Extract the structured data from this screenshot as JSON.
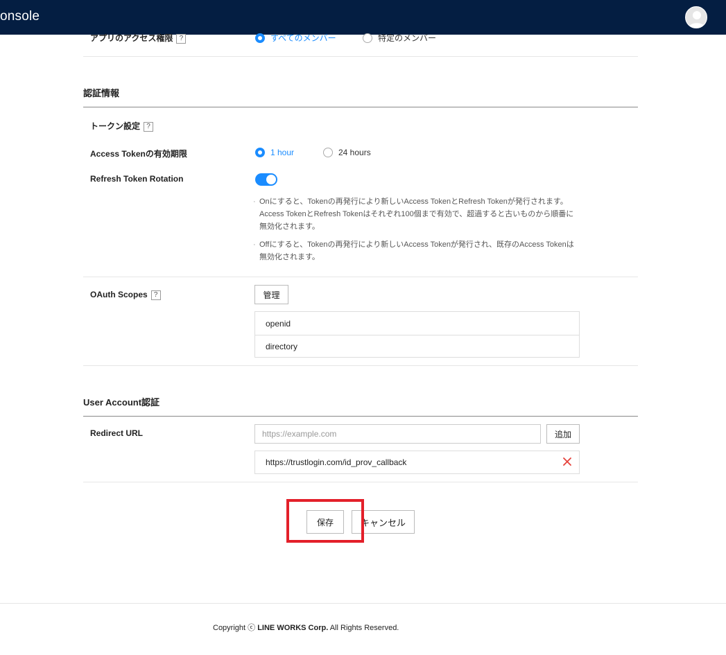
{
  "header": {
    "title": "onsole"
  },
  "access": {
    "label": "アプリのアクセス権限",
    "help": "?",
    "options": [
      "すべてのメンバー",
      "特定のメンバー"
    ],
    "selected": "すべてのメンバー"
  },
  "auth_section": {
    "title": "認証情報",
    "token_settings": {
      "label": "トークン設定",
      "help": "?"
    },
    "access_token": {
      "label": "Access Tokenの有効期限",
      "options": [
        "1 hour",
        "24 hours"
      ],
      "selected": "1 hour"
    },
    "refresh_rotation": {
      "label": "Refresh Token Rotation",
      "enabled": true,
      "notes": [
        "Onにすると、Tokenの再発行により新しいAccess TokenとRefresh Tokenが発行されます。Access TokenとRefresh Tokenはそれぞれ100個まで有効で、超過すると古いものから順番に無効化されます。",
        "Offにすると、Tokenの再発行により新しいAccess Tokenが発行され、既存のAccess Tokenは無効化されます。"
      ]
    },
    "oauth_scopes": {
      "label": "OAuth Scopes",
      "help": "?",
      "manage_label": "管理",
      "scopes": [
        "openid",
        "directory"
      ]
    }
  },
  "user_account": {
    "title": "User Account認証",
    "redirect_label": "Redirect URL",
    "input_placeholder": "https://example.com",
    "add_label": "追加",
    "urls": [
      "https://trustlogin.com/id_prov_callback"
    ]
  },
  "actions": {
    "save_label": "保存",
    "cancel_label": "キャンセル"
  },
  "footer": {
    "prefix": "Copyright ",
    "symbol": "ⓒ",
    "company": "LINE WORKS Corp.",
    "suffix": " All Rights Reserved."
  },
  "colors": {
    "header_bg": "#041e42",
    "accent": "#1a8cff",
    "highlight": "#e3202a",
    "delete": "#e5413a"
  }
}
